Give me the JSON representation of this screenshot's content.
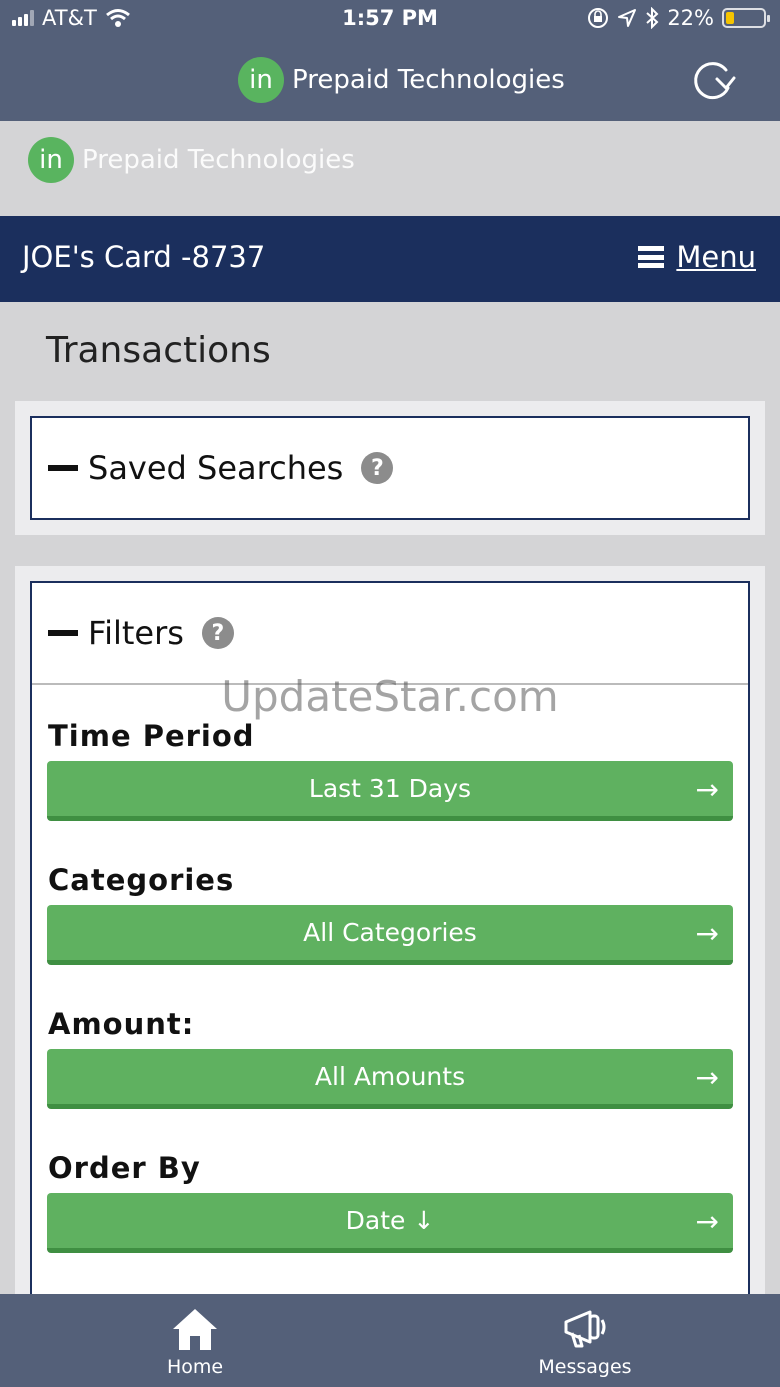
{
  "status_bar": {
    "carrier": "AT&T",
    "time": "1:57 PM",
    "battery": "22%",
    "battery_level": 0.22
  },
  "app_header": {
    "logo_text": "in",
    "brand": "Prepaid Technologies"
  },
  "site_banner": {
    "logo_text": "in",
    "brand": "Prepaid Technologies"
  },
  "card_bar": {
    "title": "JOE's Card -8737",
    "menu_label": "Menu"
  },
  "page": {
    "title": "Transactions"
  },
  "saved_searches": {
    "label": "Saved Searches",
    "help": "?"
  },
  "filters": {
    "label": "Filters",
    "help": "?",
    "items": [
      {
        "label": "Time Period",
        "value": "Last 31 Days"
      },
      {
        "label": "Categories",
        "value": "All Categories"
      },
      {
        "label": "Amount:",
        "value": "All Amounts"
      },
      {
        "label": "Order By",
        "value": "Date ↓"
      }
    ],
    "arrow": "→"
  },
  "watermark": "UpdateStar.com",
  "tab_bar": {
    "home": "Home",
    "messages": "Messages"
  },
  "colors": {
    "header": "#546079",
    "card_bar": "#1b2f5d",
    "button": "#5fb160",
    "logo": "#59b45f"
  }
}
